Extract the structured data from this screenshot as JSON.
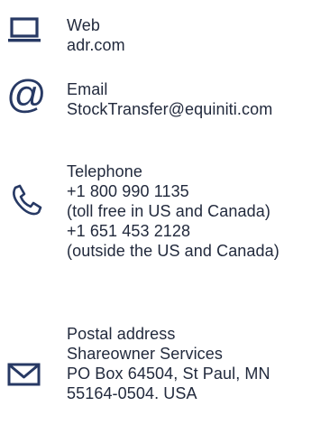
{
  "colors": {
    "icon": "#273964",
    "text": "#222a3d",
    "background": "#ffffff"
  },
  "contacts": {
    "web": {
      "icon": "laptop-icon",
      "label": "Web",
      "lines": [
        "adr.com"
      ]
    },
    "email": {
      "icon": "at-sign-icon",
      "label": "Email",
      "lines": [
        "StockTransfer@equiniti.com"
      ]
    },
    "telephone": {
      "icon": "phone-icon",
      "label": "Telephone",
      "lines": [
        "+1 800 990 1135",
        "(toll free in US and Canada)",
        "+1 651 453 2128",
        "(outside the US and Canada)"
      ]
    },
    "postal": {
      "icon": "envelope-icon",
      "label": "Postal address",
      "lines": [
        "Shareowner Services",
        "PO Box 64504, St Paul, MN",
        "55164-0504. USA"
      ]
    }
  }
}
